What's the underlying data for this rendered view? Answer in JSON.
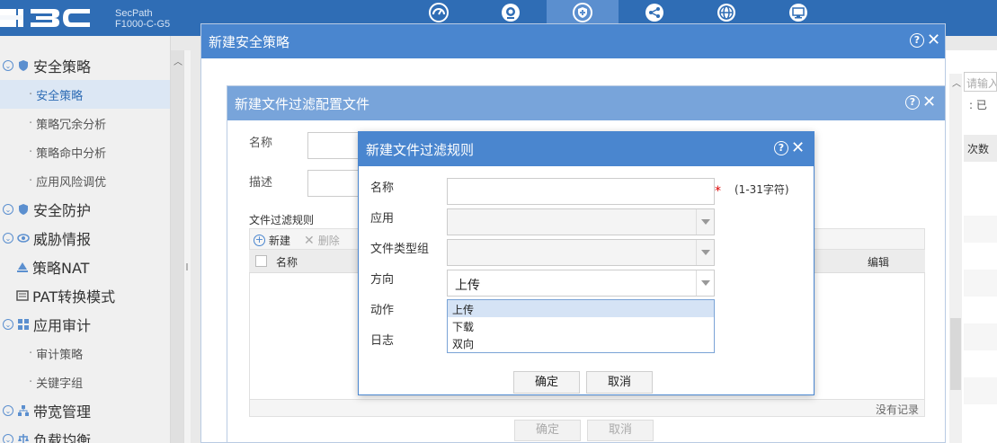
{
  "brand": {
    "logo_text": "H3C",
    "product_line1": "SecPath",
    "product_line2": "F1000-C-G5"
  },
  "top_nav": [
    {
      "icon": "dashboard-icon"
    },
    {
      "icon": "monitor-eye-icon"
    },
    {
      "icon": "shield-icon",
      "active": true
    },
    {
      "icon": "network-share-icon"
    },
    {
      "icon": "globe-icon"
    },
    {
      "icon": "system-monitor-icon"
    }
  ],
  "sidebar": {
    "items": [
      {
        "label": "安全策略",
        "level": 1
      },
      {
        "label": "安全策略",
        "level": 2,
        "active": true
      },
      {
        "label": "策略冗余分析",
        "level": 2
      },
      {
        "label": "策略命中分析",
        "level": 2
      },
      {
        "label": "应用风险调优",
        "level": 2
      },
      {
        "label": "安全防护",
        "level": 1
      },
      {
        "label": "威胁情报",
        "level": 1
      },
      {
        "label": "策略NAT",
        "level": 1
      },
      {
        "label": "PAT转换模式",
        "level": 1
      },
      {
        "label": "应用审计",
        "level": 1
      },
      {
        "label": "审计策略",
        "level": 2
      },
      {
        "label": "关键字组",
        "level": 2
      },
      {
        "label": "带宽管理",
        "level": 1
      },
      {
        "label": "负载均衡",
        "level": 1
      }
    ]
  },
  "background": {
    "search_placeholder": "请输入",
    "status_label": "已",
    "column_header": "次数"
  },
  "dialog_policy": {
    "title": "新建安全策略"
  },
  "dialog_profile": {
    "title": "新建文件过滤配置文件",
    "name_label": "名称",
    "desc_label": "描述",
    "rules_title": "文件过滤规则",
    "new_label": "新建",
    "delete_label": "删除",
    "col_name": "名称",
    "col_edit": "编辑",
    "empty_text": "没有记录",
    "ok_label": "确定",
    "cancel_label": "取消"
  },
  "dialog_rule": {
    "title": "新建文件过滤规则",
    "name_label": "名称",
    "name_value": "",
    "required_mark": "*",
    "name_hint": "(1-31字符)",
    "app_label": "应用",
    "app_value": "",
    "filetype_label": "文件类型组",
    "filetype_value": "",
    "direction_label": "方向",
    "direction_value": "上传",
    "direction_options": [
      "上传",
      "下载",
      "双向"
    ],
    "action_label": "动作",
    "log_label": "日志",
    "ok_label": "确定",
    "cancel_label": "取消"
  },
  "colors": {
    "accent": "#4a86cf",
    "topbar": "#2f6db5",
    "required": "#dd0000"
  }
}
